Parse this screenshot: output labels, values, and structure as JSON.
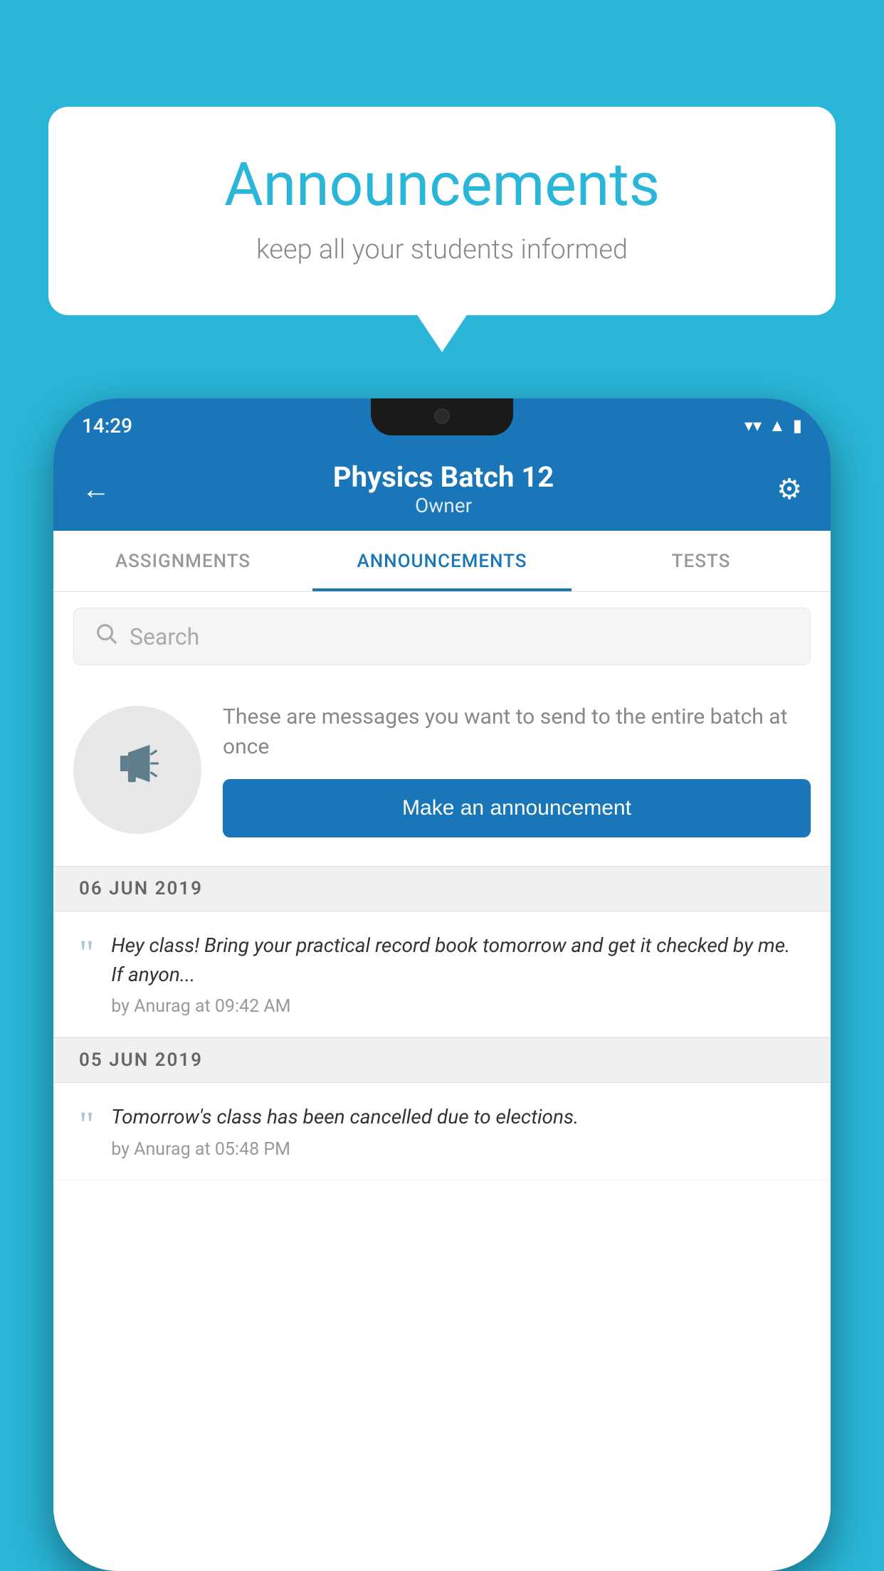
{
  "background_color": "#29b6d8",
  "bubble": {
    "title": "Announcements",
    "subtitle": "keep all your students informed"
  },
  "phone": {
    "status_bar": {
      "time": "14:29",
      "icons": [
        "wifi",
        "signal",
        "battery"
      ]
    },
    "header": {
      "title": "Physics Batch 12",
      "subtitle": "Owner",
      "back_label": "←",
      "gear_label": "⚙"
    },
    "tabs": [
      {
        "label": "ASSIGNMENTS",
        "active": false
      },
      {
        "label": "ANNOUNCEMENTS",
        "active": true
      },
      {
        "label": "TESTS",
        "active": false
      }
    ],
    "search": {
      "placeholder": "Search"
    },
    "announcement_prompt": {
      "description": "These are messages you want to send to the entire batch at once",
      "button_label": "Make an announcement"
    },
    "date_groups": [
      {
        "date": "06  JUN  2019",
        "items": [
          {
            "text": "Hey class! Bring your practical record book tomorrow and get it checked by me. If anyon...",
            "meta": "by Anurag at 09:42 AM"
          }
        ]
      },
      {
        "date": "05  JUN  2019",
        "items": [
          {
            "text": "Tomorrow's class has been cancelled due to elections.",
            "meta": "by Anurag at 05:48 PM"
          }
        ]
      }
    ]
  }
}
